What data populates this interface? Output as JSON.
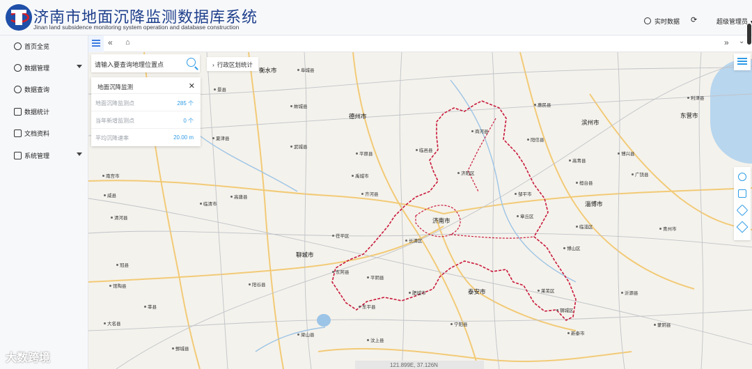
{
  "header": {
    "title": "济南市地面沉降监测数据库系统",
    "subtitle": "Jinan land subsidence monitoring system operation and database construction",
    "realtime_label": "实时数据",
    "user_label": "超级管理员"
  },
  "sidebar": {
    "items": [
      {
        "label": "首页全览",
        "icon": "cube-icon"
      },
      {
        "label": "数据管理",
        "icon": "database-icon"
      },
      {
        "label": "数据查询",
        "icon": "chart-line-icon"
      },
      {
        "label": "数据统计",
        "icon": "bar-chart-icon"
      },
      {
        "label": "文档资料",
        "icon": "document-icon"
      },
      {
        "label": "系统管理",
        "icon": "settings-icon"
      }
    ]
  },
  "search": {
    "placeholder": "请输入要查询地理位置点"
  },
  "region_button": {
    "label": "行政区划统计"
  },
  "panel": {
    "title": "地面沉降监测",
    "rows": [
      {
        "label": "地面沉降监测点",
        "value": "285 个"
      },
      {
        "label": "当年新增监测点",
        "value": "0 个"
      },
      {
        "label": "平均沉降速率",
        "value": "20.00 m"
      }
    ]
  },
  "map": {
    "cities": [
      "德州市",
      "济南市",
      "淄博市",
      "聊城市",
      "泰安市",
      "滨州市",
      "东营市",
      "衡水市"
    ],
    "labels": [
      "夏津县",
      "武城县",
      "平原县",
      "临邑县",
      "商河县",
      "惠民县",
      "阳信县",
      "广饶县",
      "高唐县",
      "齐河县",
      "禹城市",
      "济阳区",
      "章丘区",
      "邹平市",
      "桓台县",
      "临淄区",
      "茌平区",
      "东阿县",
      "平阴县",
      "长清区",
      "肥城市",
      "新泰市",
      "莱芜区",
      "钢城区",
      "博山区",
      "沂源县",
      "阳谷县",
      "东平县",
      "宁阳县",
      "蒙阴县",
      "莘县",
      "冠县",
      "临清市",
      "清河县",
      "故城县",
      "景县",
      "阜城县",
      "南宫市",
      "威县",
      "馆陶县",
      "大名县",
      "梁山县",
      "汶上县",
      "鄄城县",
      "青州市",
      "博兴县",
      "高青县",
      "利津县"
    ],
    "coordinate_text": "121.899E, 37.126N"
  },
  "watermark": "大数跨境",
  "colors": {
    "accent": "#2e9be6",
    "boundary": "#c8183a",
    "title": "#1e3f8c"
  }
}
